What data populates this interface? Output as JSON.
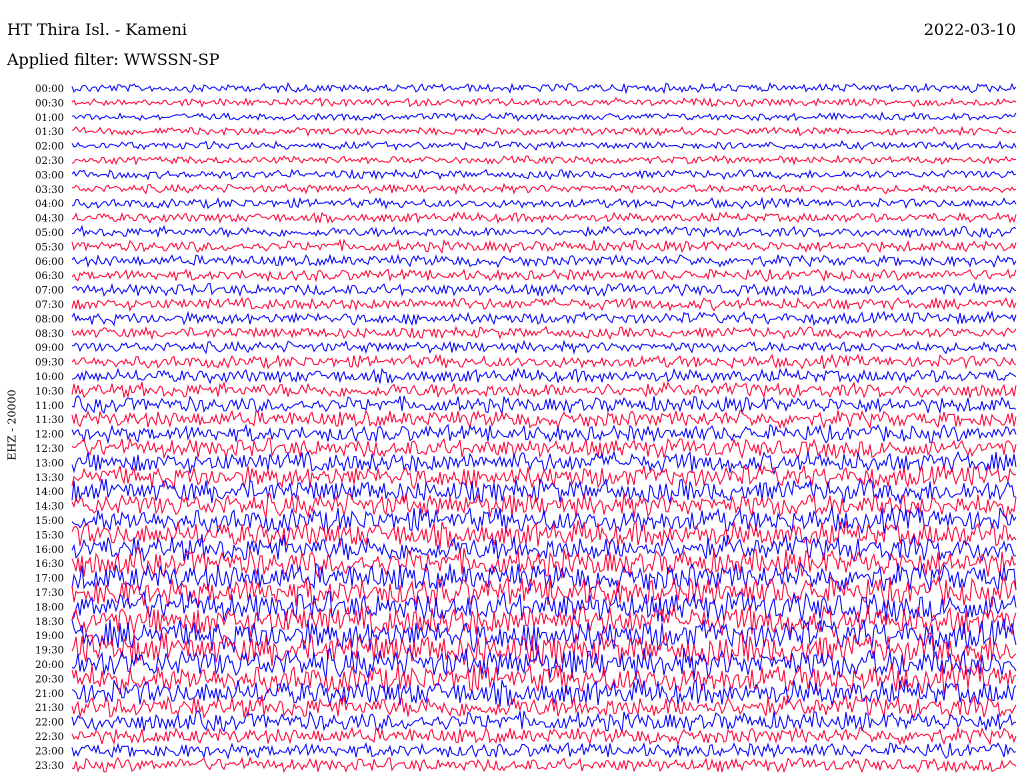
{
  "header": {
    "station": "HT Thira Isl. - Kameni",
    "date": "2022-03-10",
    "filter": "Applied filter: WWSSN-SP"
  },
  "chart_data": {
    "type": "line",
    "title": "HT Thira Isl. - Kameni",
    "subtitle": "Applied filter: WWSSN-SP",
    "ylabel": "EHZ - 20000",
    "row_labels": [
      "00:00",
      "00:30",
      "01:00",
      "01:30",
      "02:00",
      "02:30",
      "03:00",
      "03:30",
      "04:00",
      "04:30",
      "05:00",
      "05:30",
      "06:00",
      "06:30",
      "07:00",
      "07:30",
      "08:00",
      "08:30",
      "09:00",
      "09:30",
      "10:00",
      "10:30",
      "11:00",
      "11:30",
      "12:00",
      "12:30",
      "13:00",
      "13:30",
      "14:00",
      "14:30",
      "15:00",
      "15:30",
      "16:00",
      "16:30",
      "17:00",
      "17:30",
      "18:00",
      "18:30",
      "19:00",
      "19:30",
      "20:00",
      "20:30",
      "21:00",
      "21:30",
      "22:00",
      "22:30",
      "23:00",
      "23:30"
    ],
    "series_colors": [
      "#0000ff",
      "#ff0033"
    ],
    "amplitude_levels": [
      0.55,
      0.5,
      0.45,
      0.5,
      0.5,
      0.5,
      0.55,
      0.55,
      0.6,
      0.6,
      0.65,
      0.7,
      0.7,
      0.7,
      0.75,
      0.75,
      0.75,
      0.7,
      0.7,
      0.8,
      0.85,
      0.95,
      1.0,
      1.05,
      1.05,
      1.2,
      1.3,
      1.4,
      1.45,
      1.5,
      1.55,
      1.6,
      1.65,
      1.7,
      1.75,
      1.8,
      1.85,
      1.9,
      1.95,
      2.0,
      1.9,
      1.8,
      1.6,
      1.4,
      1.2,
      1.0,
      0.9,
      0.85
    ],
    "grid": false,
    "legend": "none"
  }
}
